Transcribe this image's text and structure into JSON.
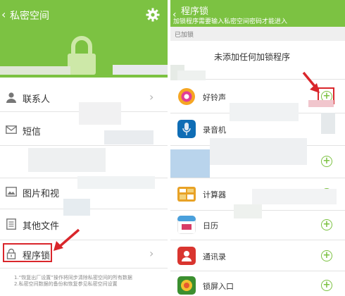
{
  "left": {
    "title": "私密空间",
    "back_icon": "chevron-left-icon",
    "settings_icon": "gear-icon",
    "hero_icon": "padlock-icon",
    "items": [
      {
        "label": "联系人",
        "icon": "person-icon"
      },
      {
        "label": "短信",
        "icon": "envelope-icon"
      },
      {
        "label": "",
        "icon": ""
      },
      {
        "label": "图片和视",
        "icon": "picture-icon"
      },
      {
        "label": "其他文件",
        "icon": "document-icon"
      },
      {
        "label": "程序锁",
        "icon": "lock-icon"
      }
    ],
    "notes": [
      "1.“恢复出厂设置”操作将同步清除私密空间的所有数据",
      "2.私密空间数据的备份和恢复参见私密空间设置"
    ]
  },
  "right": {
    "title": "程序锁",
    "subtitle": "加锁程序需要输入私密空间密码才能进入",
    "section_label": "已加锁",
    "empty_text": "未添加任何加锁程序",
    "apps": [
      {
        "label": "好铃声",
        "icon": "ringtone-icon"
      },
      {
        "label": "录音机",
        "icon": "microphone-icon"
      },
      {
        "label": "",
        "icon": "gallery-icon"
      },
      {
        "label": "计算器",
        "icon": "calculator-icon"
      },
      {
        "label": "日历",
        "icon": "calendar-icon"
      },
      {
        "label": "通讯录",
        "icon": "contacts-icon"
      },
      {
        "label": "锁屏入口",
        "icon": "lockscreen-icon"
      }
    ],
    "plus_glyph": "+"
  },
  "colors": {
    "accent": "#7cc242",
    "highlight": "#d9262b"
  }
}
